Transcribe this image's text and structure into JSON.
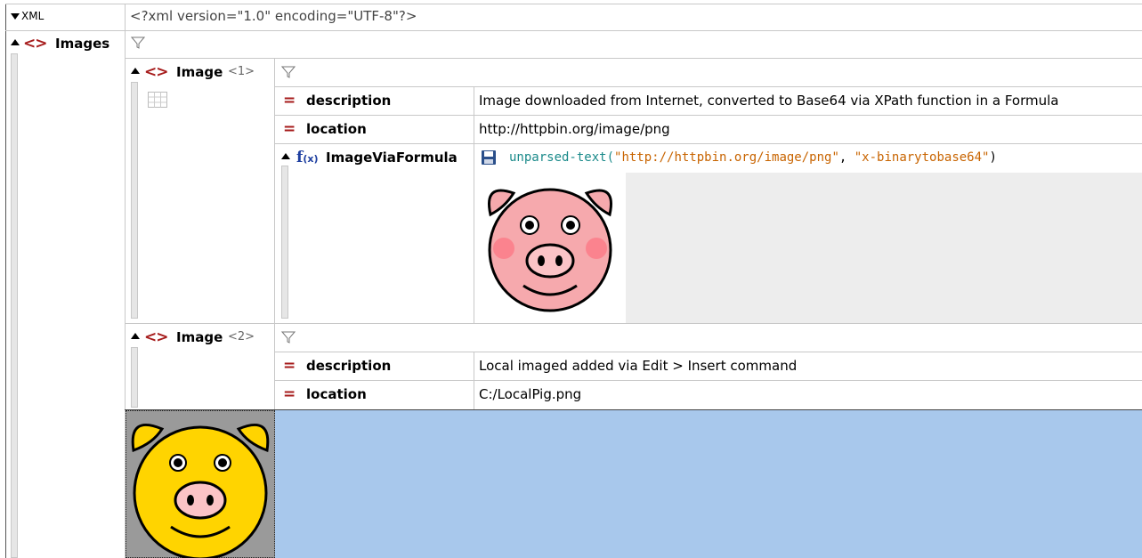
{
  "xml_row": {
    "label": "XML",
    "declaration": "<?xml version=\"1.0\" encoding=\"UTF-8\"?>"
  },
  "root": {
    "name": "Images",
    "icon": "element-icon"
  },
  "image1": {
    "name": "Image",
    "index": "<1>",
    "attributes": [
      {
        "name": "description",
        "value": "Image downloaded from Internet, converted to Base64 via XPath function in a Formula"
      },
      {
        "name": "location",
        "value": "http://httpbin.org/image/png"
      }
    ],
    "formula": {
      "name": "ImageViaFormula",
      "fn_icon": "f(x)",
      "func": "unparsed-text(",
      "arg1": "\"http://httpbin.org/image/png\"",
      "sep": ", ",
      "arg2": "\"x-binarytobase64\"",
      "close": ")"
    }
  },
  "image2": {
    "name": "Image",
    "index": "<2>",
    "attributes": [
      {
        "name": "description",
        "value": "Local imaged added via Edit  > Insert command"
      },
      {
        "name": "location",
        "value": "C:/LocalPig.png"
      }
    ]
  },
  "colors": {
    "element": "#a61b1b",
    "selection": "#a8c8ec",
    "pink_pig": "#f6a9ad",
    "yellow_pig": "#ffd400",
    "formula_func": "#1a8a8a",
    "formula_string": "#c86400"
  }
}
